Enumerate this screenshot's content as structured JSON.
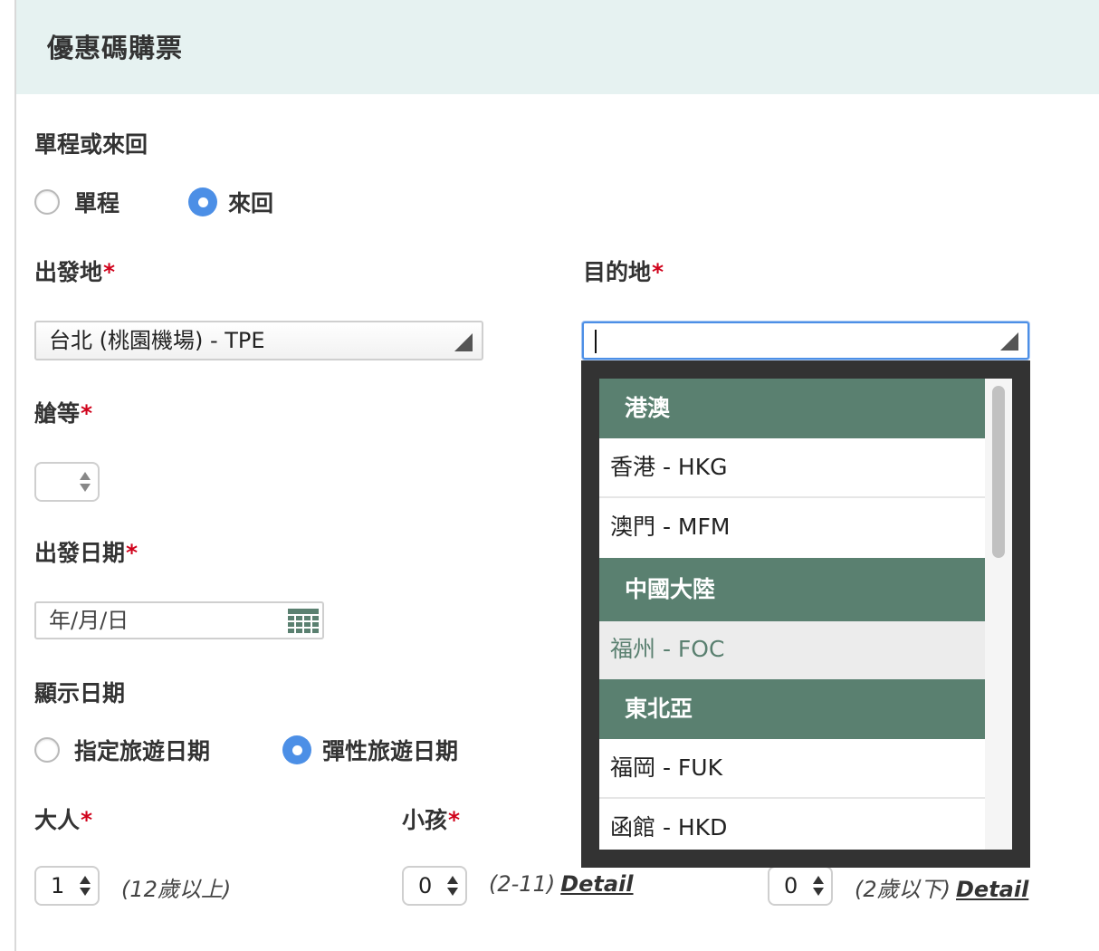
{
  "header": {
    "title": "優惠碼購票"
  },
  "trip_type": {
    "label": "單程或來回",
    "options": [
      {
        "label": "單程",
        "checked": false
      },
      {
        "label": "來回",
        "checked": true
      }
    ]
  },
  "origin": {
    "label": "出發地",
    "required_mark": "*",
    "value": "台北 (桃園機場) - TPE"
  },
  "destination": {
    "label": "目的地",
    "required_mark": "*",
    "value": "",
    "dropdown": [
      {
        "type": "group",
        "label": "港澳"
      },
      {
        "type": "option",
        "label": "香港 - HKG"
      },
      {
        "type": "option",
        "label": "澳門 - MFM"
      },
      {
        "type": "group",
        "label": "中國大陸"
      },
      {
        "type": "option",
        "label": "福州 - FOC",
        "hovered": true
      },
      {
        "type": "group",
        "label": "東北亞"
      },
      {
        "type": "option",
        "label": "福岡 - FUK"
      },
      {
        "type": "option",
        "label": "函館 - HKD"
      }
    ]
  },
  "cabin": {
    "label": "艙等",
    "required_mark": "*",
    "value": ""
  },
  "depart_date": {
    "label": "出發日期",
    "required_mark": "*",
    "placeholder": "年/月/日"
  },
  "display_date": {
    "label": "顯示日期",
    "options": [
      {
        "label": "指定旅遊日期",
        "checked": false
      },
      {
        "label": "彈性旅遊日期",
        "checked": true
      }
    ]
  },
  "passengers": {
    "adult": {
      "label": "大人",
      "required_mark": "*",
      "value": "1",
      "hint": "(12歲以上)"
    },
    "child": {
      "label": "小孩",
      "required_mark": "*",
      "value": "0",
      "hint": "(2-11)",
      "link": "Detail"
    },
    "infant": {
      "value": "0",
      "hint": "(2歲以下)",
      "link": "Detail"
    }
  },
  "colors": {
    "header_bg": "#e6f2f1",
    "group_bg": "#5a8070",
    "radio_checked": "#4c8fe6",
    "required": "#d0021b",
    "dropdown_frame": "#333333"
  }
}
